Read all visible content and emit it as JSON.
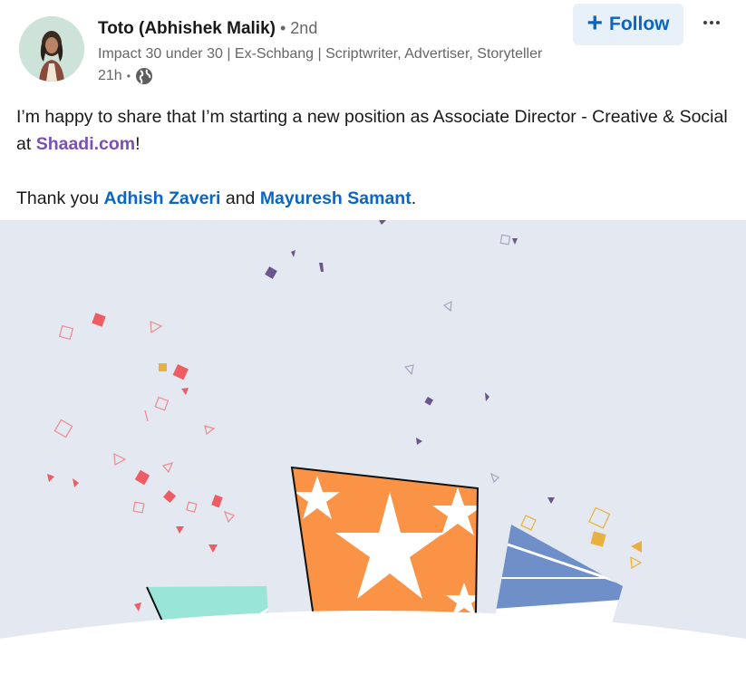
{
  "author": {
    "name": "Toto (Abhishek Malik)",
    "degree_sep": " • ",
    "degree": "2nd",
    "headline": "Impact 30 under 30 | Ex-Schbang | Scriptwriter, Advertiser, Storyteller",
    "time": "21h",
    "time_sep": " • ",
    "visibility_icon": "globe-icon"
  },
  "actions": {
    "follow_label": "Follow",
    "follow_icon": "+",
    "more_icon": "more-horizontal-icon"
  },
  "post": {
    "line1_prefix": "I’m happy to share that I’m starting a new position as Associate Director - Creative & Social at ",
    "company": "Shaadi.com",
    "line1_suffix": "!",
    "thanks_prefix": "Thank you ",
    "mention1": "Adhish Zaveri",
    "thanks_mid": " and ",
    "mention2": "Mayuresh Samant",
    "thanks_suffix": "."
  },
  "colors": {
    "link": "#0a66c2",
    "company_link": "#7b4fb5",
    "follow_bg": "#e8f1f9",
    "illustration_bg": "#e4e8f1",
    "orange": "#fb9347",
    "blue": "#6f8fc8",
    "mint": "#99e5d8",
    "confetti_red": "#ee5c64",
    "confetti_purple": "#6a568d",
    "confetti_yellow": "#e8b13d"
  }
}
